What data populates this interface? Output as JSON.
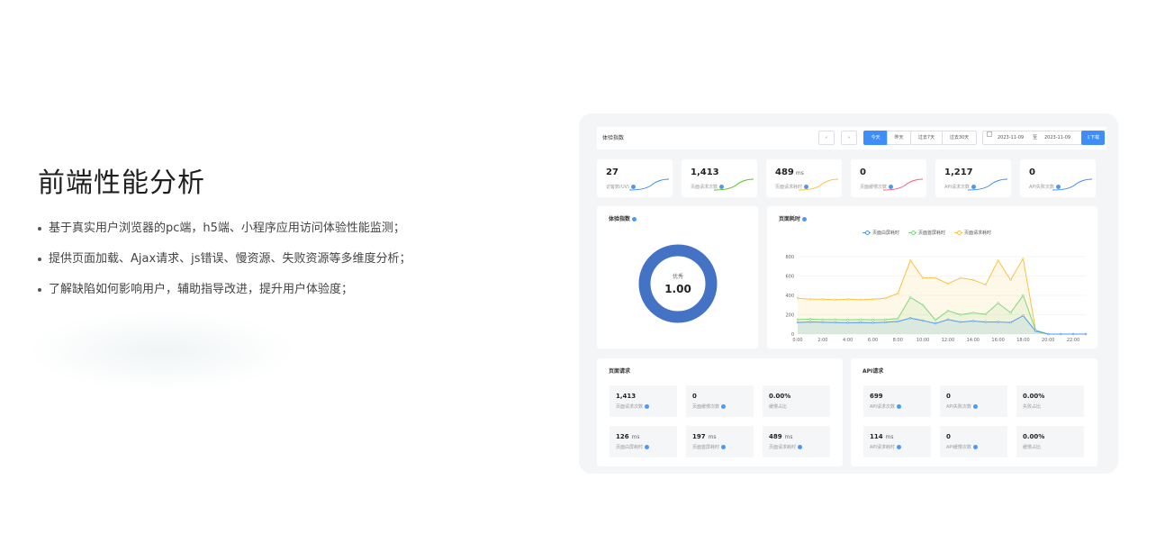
{
  "hero": {
    "title": "前端性能分析",
    "bullets": [
      "基于真实用户浏览器的pc端，h5端、小程序应用访问体验性能监测；",
      "提供页面加载、Ajax请求、js错误、慢资源、失败资源等多维度分析；",
      "了解缺陷如何影响用户，辅助指导改进，提升用户体验度；"
    ]
  },
  "dashboard": {
    "toolbar": {
      "title": "体验指数",
      "prev": "‹",
      "next": "›",
      "ranges": [
        "今天",
        "昨天",
        "过去7天",
        "过去30天"
      ],
      "active_range": "今天",
      "date_from": "2023-11-09",
      "date_sep": "至",
      "date_to": "2023-11-09",
      "download": "⇩下载"
    },
    "stats": [
      {
        "value": "27",
        "unit": "",
        "label": "访客数(UV)",
        "color": "#3e8ef7"
      },
      {
        "value": "1,413",
        "unit": "",
        "label": "页面请求次数",
        "color": "#52c41a"
      },
      {
        "value": "489",
        "unit": "ms",
        "label": "页面请求耗时",
        "color": "#f6c343"
      },
      {
        "value": "0",
        "unit": "",
        "label": "页面缓慢次数",
        "color": "#f2637b"
      },
      {
        "value": "1,217",
        "unit": "",
        "label": "API请求次数",
        "color": "#3e8ef7"
      },
      {
        "value": "0",
        "unit": "",
        "label": "API失败次数",
        "color": "#3e8ef7"
      }
    ],
    "experience": {
      "title": "体验指数",
      "grade": "优秀",
      "score": "1.00",
      "score_fraction": 1.0,
      "ring_color": "#4472c4"
    },
    "page_time": {
      "title": "页面耗时"
    },
    "page_requests": {
      "title": "页面请求",
      "cells": [
        {
          "value": "1,413",
          "unit": "",
          "label": "页面请求次数"
        },
        {
          "value": "0",
          "unit": "",
          "label": "页面缓慢次数"
        },
        {
          "value": "0.00%",
          "unit": "",
          "label": "缓慢占比"
        },
        {
          "value": "126",
          "unit": "ms",
          "label": "页面白屏耗时"
        },
        {
          "value": "197",
          "unit": "ms",
          "label": "页面首屏耗时"
        },
        {
          "value": "489",
          "unit": "ms",
          "label": "页面请求耗时"
        }
      ]
    },
    "api_requests": {
      "title": "API请求",
      "cells": [
        {
          "value": "699",
          "unit": "",
          "label": "API请求次数"
        },
        {
          "value": "0",
          "unit": "",
          "label": "API失败次数"
        },
        {
          "value": "0.00%",
          "unit": "",
          "label": "失败占比"
        },
        {
          "value": "114",
          "unit": "ms",
          "label": "API请求耗时"
        },
        {
          "value": "0",
          "unit": "",
          "label": "API缓慢次数"
        },
        {
          "value": "0.00%",
          "unit": "",
          "label": "缓慢占比"
        }
      ]
    }
  },
  "chart_data": {
    "type": "line",
    "title": "页面耗时",
    "x": [
      "0:00",
      "1:00",
      "2:00",
      "3:00",
      "4:00",
      "5:00",
      "6:00",
      "7:00",
      "8:00",
      "9:00",
      "10:00",
      "11:00",
      "12:00",
      "13:00",
      "14:00",
      "15:00",
      "16:00",
      "17:00",
      "18:00",
      "19:00",
      "20:00",
      "21:00",
      "22:00",
      "23:00"
    ],
    "x_tick_labels": [
      "0:00",
      "2:00",
      "4:00",
      "6:00",
      "8:00",
      "10:00",
      "12:00",
      "14:00",
      "16:00",
      "18:00",
      "20:00",
      "22:00"
    ],
    "ylim": [
      0,
      800
    ],
    "y_ticks": [
      0,
      200,
      400,
      600,
      800
    ],
    "grid": true,
    "legend_position": "top-center",
    "series": [
      {
        "name": "页面白屏耗时",
        "color": "#4a9af5",
        "values": [
          120,
          125,
          122,
          120,
          118,
          120,
          118,
          122,
          130,
          165,
          140,
          110,
          150,
          125,
          135,
          125,
          125,
          120,
          190,
          30,
          0,
          0,
          0,
          0
        ]
      },
      {
        "name": "页面首屏耗时",
        "color": "#7dd87d",
        "values": [
          150,
          155,
          150,
          150,
          148,
          150,
          148,
          150,
          160,
          380,
          300,
          145,
          240,
          200,
          220,
          205,
          320,
          220,
          400,
          40,
          0,
          0,
          0,
          0
        ]
      },
      {
        "name": "页面请求耗时",
        "color": "#f6c343",
        "values": [
          370,
          360,
          360,
          355,
          360,
          355,
          360,
          370,
          420,
          760,
          580,
          580,
          520,
          580,
          560,
          510,
          760,
          560,
          780,
          40,
          0,
          0,
          0,
          0
        ]
      }
    ]
  }
}
